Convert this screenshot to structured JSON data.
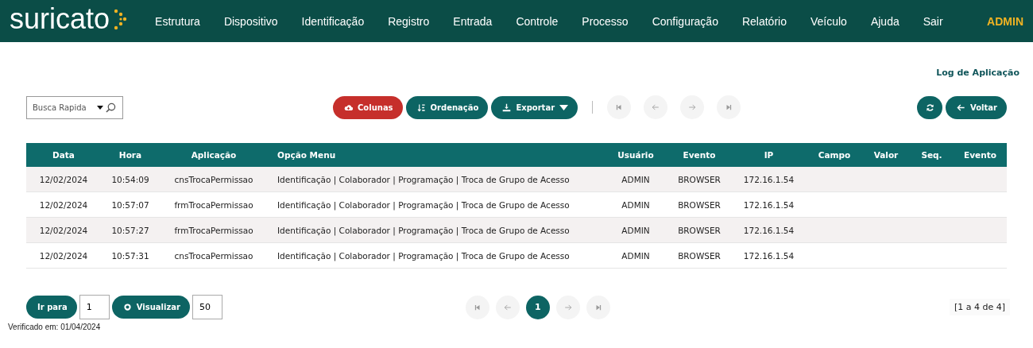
{
  "brand": {
    "name": "suricato"
  },
  "menu": [
    {
      "label": "Estrutura"
    },
    {
      "label": "Dispositivo"
    },
    {
      "label": "Identificação"
    },
    {
      "label": "Registro"
    },
    {
      "label": "Entrada"
    },
    {
      "label": "Controle"
    },
    {
      "label": "Processo"
    },
    {
      "label": "Configuração"
    },
    {
      "label": "Relatório"
    },
    {
      "label": "Veículo"
    },
    {
      "label": "Ajuda"
    },
    {
      "label": "Sair"
    }
  ],
  "user": "ADMIN",
  "page_title": "Log de Aplicação",
  "search": {
    "placeholder": "Busca Rapida"
  },
  "toolbar": [
    {
      "label": "Colunas",
      "kind": "cloud",
      "color": "#c62f2b"
    },
    {
      "label": "Ordenação",
      "kind": "sort",
      "color": "#0d6463"
    },
    {
      "label": "Exportar",
      "kind": "export",
      "color": "#0d6463"
    }
  ],
  "top_pager": [
    {
      "kind": "first",
      "disabled": true
    },
    {
      "kind": "prev",
      "disabled": true
    },
    {
      "kind": "next",
      "disabled": true
    },
    {
      "kind": "last",
      "disabled": true
    }
  ],
  "back_button": {
    "label": "Voltar"
  },
  "table": {
    "columns": [
      {
        "label": "Data"
      },
      {
        "label": "Hora"
      },
      {
        "label": "Aplicação"
      },
      {
        "label": "Opção Menu"
      },
      {
        "label": "Usuário"
      },
      {
        "label": "Evento"
      },
      {
        "label": "IP"
      },
      {
        "label": "Campo"
      },
      {
        "label": "Valor"
      },
      {
        "label": "Seq."
      },
      {
        "label": "Evento"
      }
    ],
    "rows": [
      [
        "12/02/2024",
        "10:54:09",
        "cnsTrocaPermissao",
        "Identificação | Colaborador | Programação | Troca de Grupo de Acesso",
        "ADMIN",
        "BROWSER",
        "172.16.1.54",
        "",
        "",
        "",
        ""
      ],
      [
        "12/02/2024",
        "10:57:07",
        "frmTrocaPermissao",
        "Identificação | Colaborador | Programação | Troca de Grupo de Acesso",
        "ADMIN",
        "BROWSER",
        "172.16.1.54",
        "",
        "",
        "",
        ""
      ],
      [
        "12/02/2024",
        "10:57:27",
        "frmTrocaPermissao",
        "Identificação | Colaborador | Programação | Troca de Grupo de Acesso",
        "ADMIN",
        "BROWSER",
        "172.16.1.54",
        "",
        "",
        "",
        ""
      ],
      [
        "12/02/2024",
        "10:57:31",
        "cnsTrocaPermissao",
        "Identificação | Colaborador | Programação | Troca de Grupo de Acesso",
        "ADMIN",
        "BROWSER",
        "172.16.1.54",
        "",
        "",
        "",
        ""
      ]
    ]
  },
  "goto": {
    "label": "Ir para",
    "value": "1"
  },
  "view": {
    "label": "Visualizar",
    "value": "50"
  },
  "bottom_pager": [
    {
      "kind": "first",
      "disabled": true
    },
    {
      "kind": "prev",
      "disabled": true
    },
    {
      "kind": "page",
      "label": "1",
      "selected": true
    },
    {
      "kind": "next",
      "disabled": true
    },
    {
      "kind": "last",
      "disabled": true
    }
  ],
  "record_count": "[1 a 4 de 4]",
  "footer": "Verificado em: 01/04/2024"
}
